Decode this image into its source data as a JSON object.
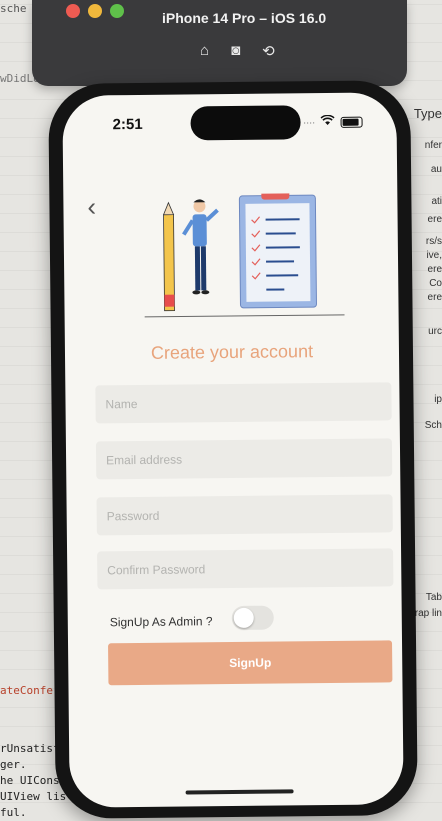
{
  "simulator": {
    "title": "iPhone 14 Pro – iOS 16.0",
    "icons": [
      "home-icon",
      "screenshot-icon",
      "rotate-icon"
    ]
  },
  "editor": {
    "left_fragments": [
      "sche",
      "wDidLoad(",
      "ateConfer",
      "rUnsatisf",
      "ger.",
      "he UIConst",
      "UIView lis",
      "ful."
    ],
    "right_fragments": [
      "Type",
      "nfer",
      "au",
      "ati",
      "ere",
      "rs/s",
      "ive,",
      "ere",
      "Co",
      "ere",
      "urc",
      "ip",
      "Sch",
      "Tab",
      "rap lin"
    ]
  },
  "status_bar": {
    "time": "2:51"
  },
  "form": {
    "title": "Create your account",
    "name_placeholder": "Name",
    "email_placeholder": "Email address",
    "password_placeholder": "Password",
    "confirm_placeholder": "Confirm Password",
    "admin_label": "SignUp As Admin ?",
    "admin_toggle_on": false,
    "submit_label": "SignUp"
  },
  "colors": {
    "accent": "#e9a987",
    "title_color": "#e8a47c",
    "field_bg": "#ecebe7"
  }
}
